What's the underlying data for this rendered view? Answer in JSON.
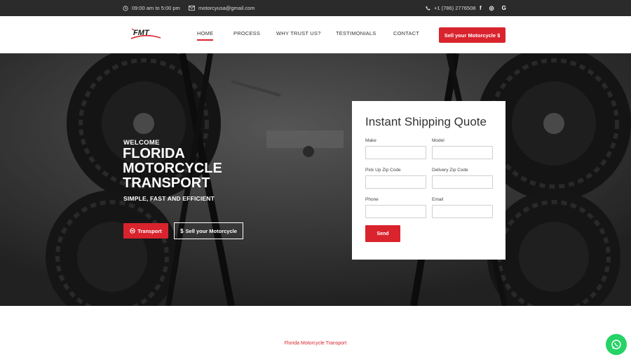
{
  "topbar": {
    "hours": "09:00 am to 5:00 pm",
    "email": "motorcyusa@gmail.com",
    "phone": "+1 (786) 2776508",
    "social": [
      "f",
      "◎",
      "G"
    ]
  },
  "nav": {
    "logo_text": "FMT",
    "links": [
      "HOME",
      "PROCESS",
      "WHY TRUST US?",
      "TESTIMONIALS",
      "CONTACT"
    ],
    "cta": "Sell your Motorcycle $"
  },
  "hero": {
    "welcome": "WELCOME",
    "title": "FLORIDA MOTORCYCLE TRANSPORT",
    "subtitle": "SIMPLE, FAST AND EFFICIENT",
    "btn_transport": "Transport",
    "btn_sell": "Sell your Motorcycle"
  },
  "quote": {
    "title": "Instant Shipping Quote",
    "fields": [
      "Make",
      "Model",
      "Pick Up Zip Code",
      "Delivery Zip Code",
      "Phone",
      "Email"
    ],
    "send": "Send"
  },
  "footer": {
    "label": "Florida Motorcycle Transport"
  },
  "colors": {
    "accent": "#d9232d",
    "topbar": "#2b2b2b",
    "whatsapp": "#25d366"
  },
  "icons": [
    "clock-icon",
    "mail-icon",
    "phone-icon",
    "facebook-icon",
    "instagram-icon",
    "google-icon",
    "steering-icon",
    "dollar-icon",
    "whatsapp-icon"
  ]
}
